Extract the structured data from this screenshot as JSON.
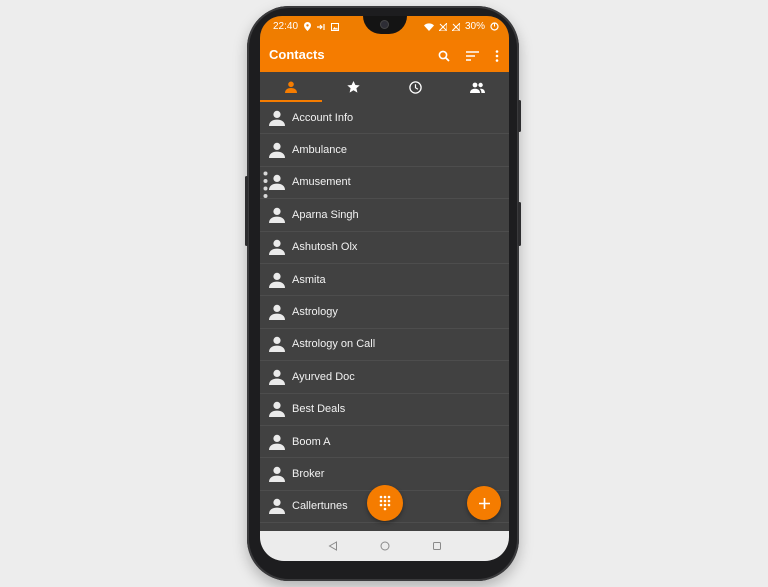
{
  "status_bar": {
    "time": "22:40",
    "battery": "30%",
    "icons": [
      "location-icon",
      "call-forward-icon",
      "image-icon",
      "wifi-icon",
      "no-signal-icon",
      "sync-icon"
    ]
  },
  "app_bar": {
    "title": "Contacts",
    "actions": [
      "search-icon",
      "sort-icon",
      "more-icon"
    ]
  },
  "tabs": [
    {
      "icon": "person-icon",
      "active": true
    },
    {
      "icon": "star-icon",
      "active": false
    },
    {
      "icon": "clock-icon",
      "active": false
    },
    {
      "icon": "group-icon",
      "active": false
    }
  ],
  "contacts": [
    "Account Info",
    "Ambulance",
    "Amusement",
    "Aparna Singh",
    "Ashutosh Olx",
    "Asmita",
    "Astrology",
    "Astrology on Call",
    "Ayurved Doc",
    "Best Deals",
    "Boom A",
    "Broker",
    "Callertunes"
  ],
  "fabs": {
    "dialpad": "dialpad-icon",
    "add": "add-icon"
  },
  "colors": {
    "accent": "#f57c00",
    "background": "#414141",
    "text": "#f2f2f2"
  }
}
